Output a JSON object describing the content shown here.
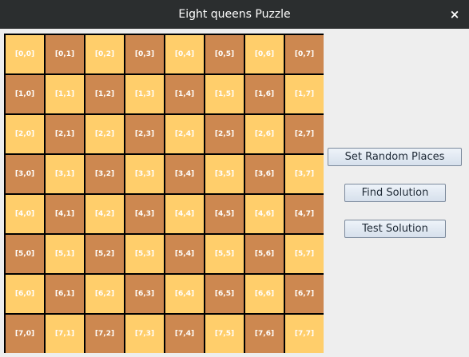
{
  "window": {
    "title": "Eight queens Puzzle",
    "close_label": "×"
  },
  "buttons": {
    "random": "Set Random Places",
    "find": "Find Solution",
    "test": "Test Solution"
  },
  "board": {
    "rows": 8,
    "cols": 8,
    "light_color": "#ffce6b",
    "dark_color": "#cd8850",
    "cells": [
      [
        "[0,0]",
        "[0,1]",
        "[0,2]",
        "[0,3]",
        "[0,4]",
        "[0,5]",
        "[0,6]",
        "[0,7]"
      ],
      [
        "[1,0]",
        "[1,1]",
        "[1,2]",
        "[1,3]",
        "[1,4]",
        "[1,5]",
        "[1,6]",
        "[1,7]"
      ],
      [
        "[2,0]",
        "[2,1]",
        "[2,2]",
        "[2,3]",
        "[2,4]",
        "[2,5]",
        "[2,6]",
        "[2,7]"
      ],
      [
        "[3,0]",
        "[3,1]",
        "[3,2]",
        "[3,3]",
        "[3,4]",
        "[3,5]",
        "[3,6]",
        "[3,7]"
      ],
      [
        "[4,0]",
        "[4,1]",
        "[4,2]",
        "[4,3]",
        "[4,4]",
        "[4,5]",
        "[4,6]",
        "[4,7]"
      ],
      [
        "[5,0]",
        "[5,1]",
        "[5,2]",
        "[5,3]",
        "[5,4]",
        "[5,5]",
        "[5,6]",
        "[5,7]"
      ],
      [
        "[6,0]",
        "[6,1]",
        "[6,2]",
        "[6,3]",
        "[6,4]",
        "[6,5]",
        "[6,6]",
        "[6,7]"
      ],
      [
        "[7,0]",
        "[7,1]",
        "[7,2]",
        "[7,3]",
        "[7,4]",
        "[7,5]",
        "[7,6]",
        "[7,7]"
      ]
    ]
  }
}
